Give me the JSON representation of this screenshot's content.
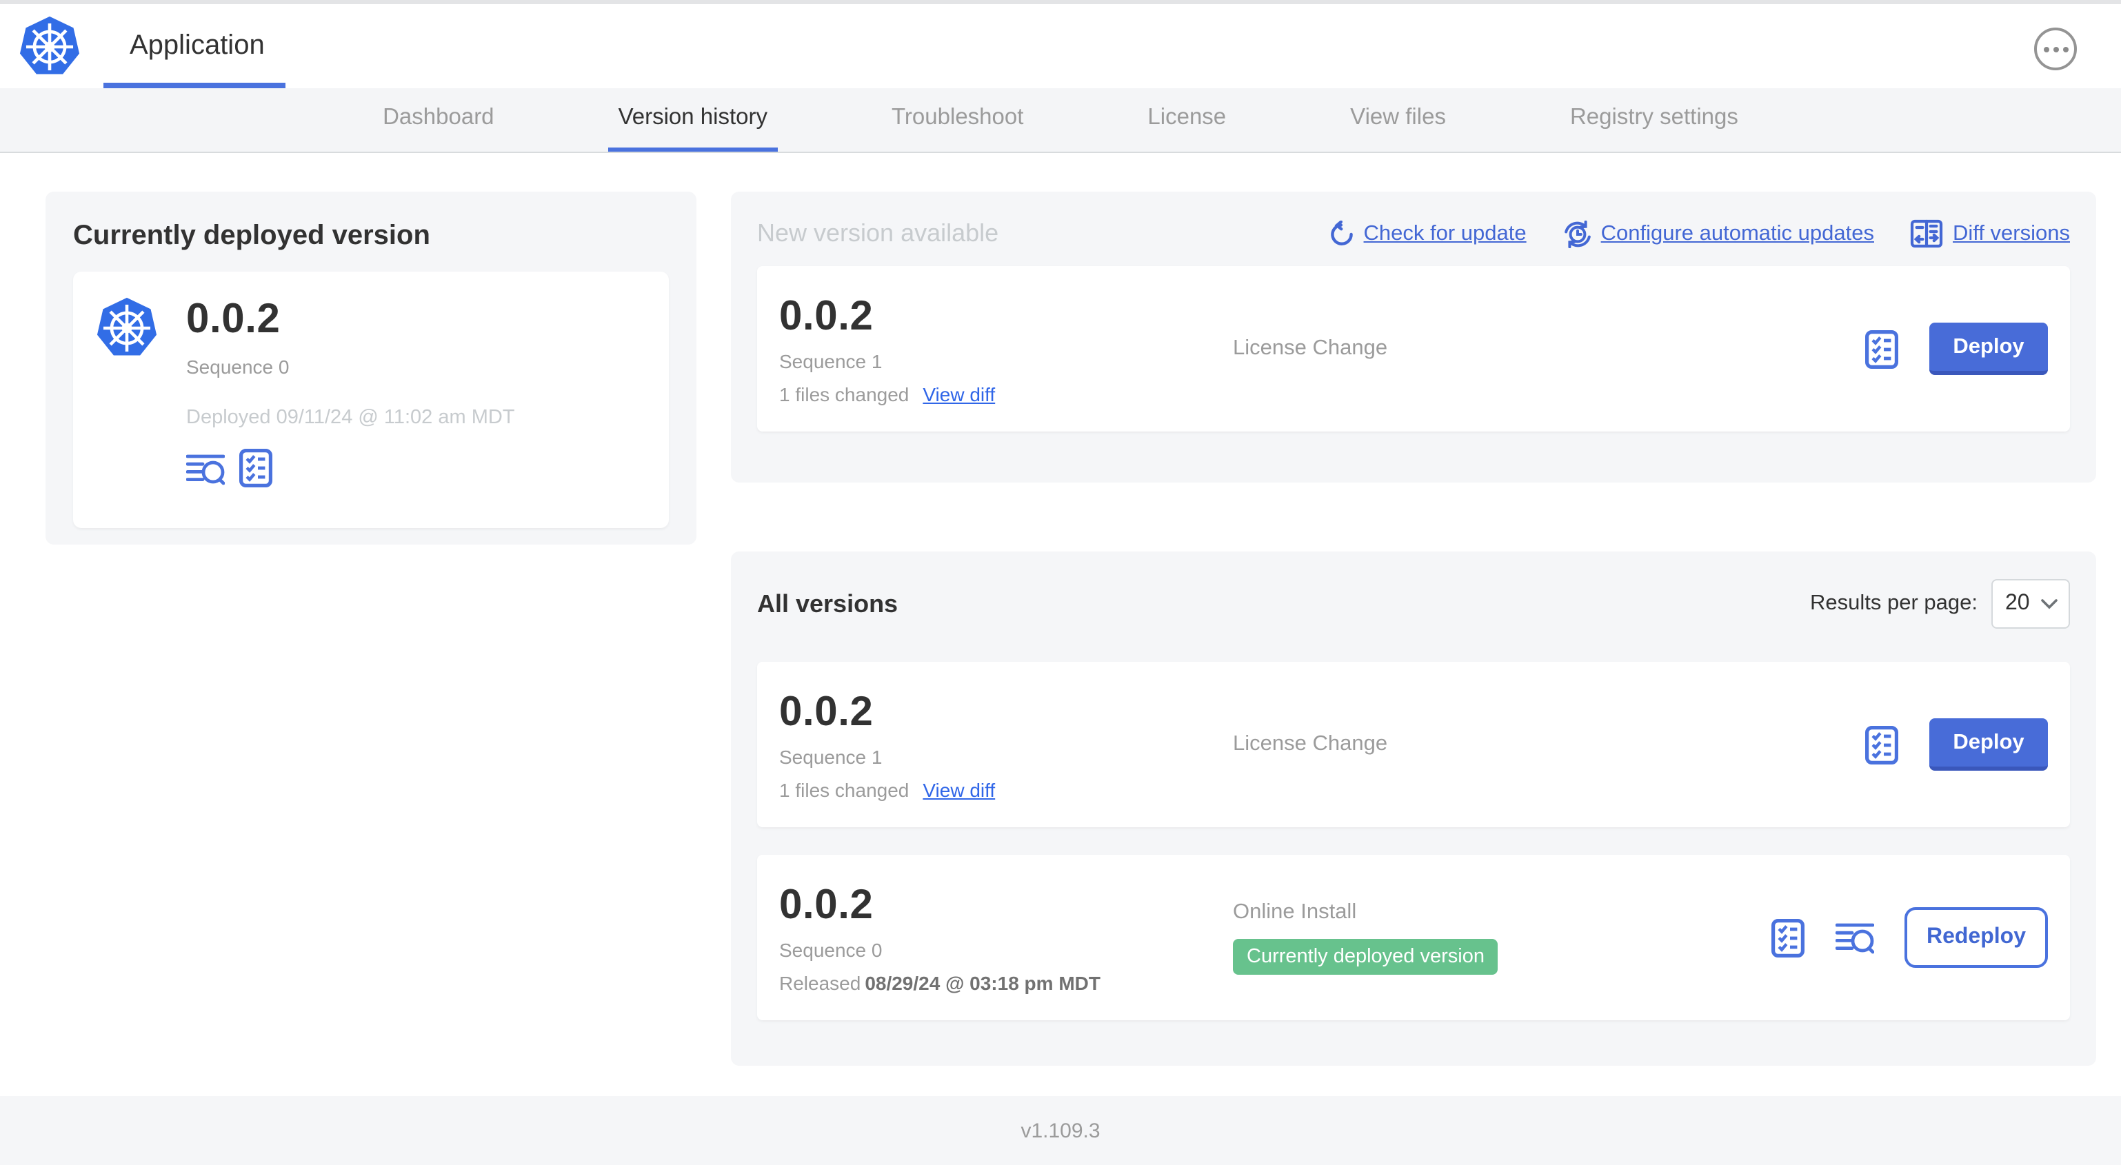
{
  "colors": {
    "accent_blue": "#4a72de",
    "button_blue": "#486cd8",
    "link_blue": "#3066e8",
    "badge_green": "#67c28d",
    "text_dark": "#323232",
    "text_gray": "#9b9b9b",
    "text_light": "#c7cbce",
    "section_bg": "#f5f6f8"
  },
  "icons": {
    "app_logo": "kubernetes-wheel",
    "more": "ellipsis-circle",
    "check_update": "refresh-arrow",
    "auto_updates": "clock-refresh",
    "diff": "split-panel-arrows",
    "preflight": "checklist-box",
    "logs": "lines-magnifier",
    "select_chevron": "chevron-down"
  },
  "header": {
    "app_tab": "Application"
  },
  "nav": {
    "tabs": [
      {
        "label": "Dashboard",
        "active": false
      },
      {
        "label": "Version history",
        "active": true
      },
      {
        "label": "Troubleshoot",
        "active": false
      },
      {
        "label": "License",
        "active": false
      },
      {
        "label": "View files",
        "active": false
      },
      {
        "label": "Registry settings",
        "active": false
      }
    ]
  },
  "current_version_panel": {
    "title": "Currently deployed version",
    "version": "0.0.2",
    "sequence": "Sequence 0",
    "deployed": "Deployed 09/11/24 @ 11:02 am MDT"
  },
  "new_version_section": {
    "title": "New version available",
    "links": [
      {
        "label": "Check for update"
      },
      {
        "label": "Configure automatic updates"
      },
      {
        "label": "Diff versions"
      }
    ],
    "card": {
      "version": "0.0.2",
      "sequence": "Sequence 1",
      "files_changed": "1 files changed",
      "view_diff": "View diff",
      "source": "License Change",
      "action": "Deploy"
    }
  },
  "all_versions_section": {
    "title": "All versions",
    "results_per_page_label": "Results per page:",
    "results_per_page_value": "20",
    "rows": [
      {
        "version": "0.0.2",
        "sequence": "Sequence 1",
        "files_changed": "1 files changed",
        "view_diff": "View diff",
        "source": "License Change",
        "action": "Deploy"
      },
      {
        "version": "0.0.2",
        "sequence": "Sequence 0",
        "released_label": "Released",
        "released_date": "08/29/24 @ 03:18 pm MDT",
        "source": "Online Install",
        "badge": "Currently deployed version",
        "action": "Redeploy"
      }
    ]
  },
  "footer": {
    "console_version": "v1.109.3"
  }
}
